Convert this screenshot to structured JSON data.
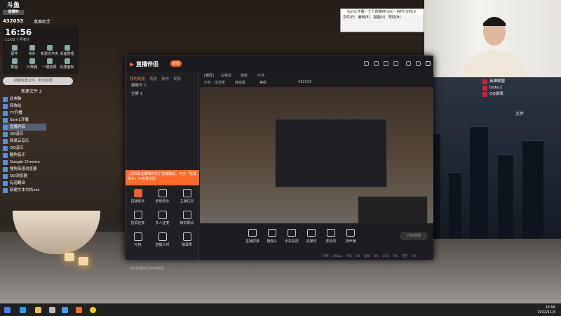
{
  "desktop": {
    "brand": "斗鱼",
    "brand_sub": "直播吧",
    "room_id": "432033",
    "widget_title": "桌面助手",
    "clock": "16:56",
    "date": "11/03 十月初十",
    "widget_items": [
      "硬件",
      "待办",
      "新建文件夹",
      "桌面整理",
      "截图",
      "计算器",
      "一键锁屏",
      "快捷面板"
    ],
    "search_placeholder": "搜索全盘文件，秒出结果",
    "folder_label": "新建文件 2",
    "icons": [
      "此电脑",
      "回收站",
      "YY开播",
      "Sam1开播",
      "直播伴侣",
      "QQ音乐",
      "网易云音乐",
      "QQ音乐",
      "酷狗音乐",
      "Google Chrome",
      "搜狗高速浏览器",
      "QQ浏览器",
      "有道翻译",
      "新建文本文档.txt"
    ],
    "right_icons": [
      "英雄联盟",
      "Dota 2",
      "QQ游戏"
    ],
    "right_label": "文件"
  },
  "doc_window": {
    "title": "Sam1开播 - 个人直播RP.xml - WPS Office",
    "menu": [
      "文件(F)",
      "编辑(E)",
      "视图(V)",
      "帮助(H)"
    ]
  },
  "app": {
    "logo": "直播伴侣",
    "version": "新版",
    "tabs": [
      "我的场景",
      "场景",
      "素材",
      "视频"
    ],
    "scenes": [
      "摄像头 2",
      "全屏 1"
    ],
    "toolbar_text": [
      "[横屏]",
      "白噪音",
      "感受",
      "户外"
    ],
    "subtitle": [
      "户外 · 生活类",
      "纯享版",
      "美颜",
      "432033"
    ],
    "promo": "上周3场直播带你切了直播赚钱，可在「管理助手」中查看详情",
    "tools": [
      "直播助手",
      "房管助手",
      "主播任务",
      "投屏连麦",
      "多人连麦",
      "精彩瞬间",
      "礼物",
      "直播计时",
      "弹幕秀",
      "营收",
      "更多功能",
      "设置"
    ],
    "footnote": "3条直播伴侣使用教程",
    "bottom_buttons": [
      "直播屏幕",
      "摄像头",
      "手机投屏",
      "多媒体",
      "麦克风",
      "扬声器"
    ],
    "start_label": "开始直播",
    "status_items": [
      "码率 0Kbps",
      "FPS 60",
      "丢帧 0%",
      "CPU 0%",
      "内存 0%",
      "丢帧"
    ]
  },
  "taskbar": {
    "time": "16:56",
    "date": "2022/11/3"
  }
}
